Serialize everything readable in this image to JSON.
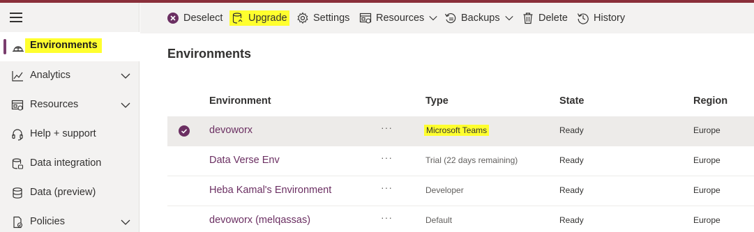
{
  "sidebar": {
    "items": [
      {
        "label": "Environments",
        "icon": "environment-icon",
        "active": true
      },
      {
        "label": "Analytics",
        "icon": "chart-line-icon",
        "expandable": true
      },
      {
        "label": "Resources",
        "icon": "resources-icon",
        "expandable": true
      },
      {
        "label": "Help + support",
        "icon": "headset-icon"
      },
      {
        "label": "Data integration",
        "icon": "data-integration-icon"
      },
      {
        "label": "Data (preview)",
        "icon": "data-icon"
      },
      {
        "label": "Policies",
        "icon": "policy-icon",
        "expandable": true
      }
    ]
  },
  "toolbar": {
    "deselect": "Deselect",
    "upgrade": "Upgrade",
    "settings": "Settings",
    "resources": "Resources",
    "backups": "Backups",
    "delete": "Delete",
    "history": "History"
  },
  "page": {
    "title": "Environments"
  },
  "table": {
    "columns": [
      "Environment",
      "Type",
      "State",
      "Region"
    ],
    "rows": [
      {
        "name": "devoworx",
        "type": "Microsoft Teams",
        "state": "Ready",
        "region": "Europe",
        "selected": true
      },
      {
        "name": "Data Verse Env",
        "type": "Trial (22 days remaining)",
        "state": "Ready",
        "region": "Europe"
      },
      {
        "name": "Heba Kamal's Environment",
        "type": "Developer",
        "state": "Ready",
        "region": "Europe"
      },
      {
        "name": "devoworx (melqassas)",
        "type": "Default",
        "state": "Ready",
        "region": "Europe"
      }
    ],
    "more_label": "···"
  },
  "colors": {
    "accent": "#7a3e6e",
    "link": "#6b2f62",
    "highlight": "#ffff2e",
    "sidebar_bg": "#f3f2f1"
  }
}
